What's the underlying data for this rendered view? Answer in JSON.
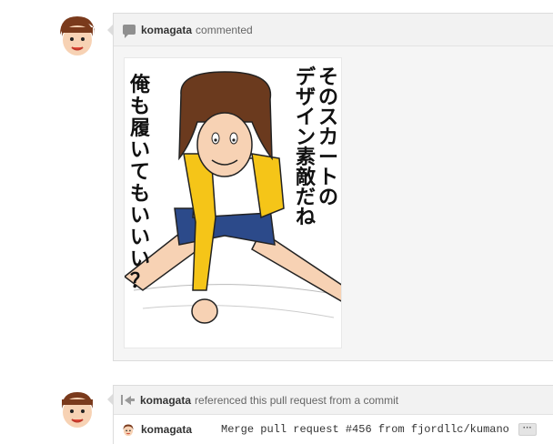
{
  "comment": {
    "author": "komagata",
    "action": "commented",
    "image": {
      "caption_right": "そのスカートのデザイン素敵だね",
      "caption_left": "俺も履いてもいいい？"
    }
  },
  "reference": {
    "author": "komagata",
    "action": "referenced this pull request from a commit",
    "commit": {
      "author": "komagata",
      "message": "Merge pull request #456 from fjordllc/kumano",
      "more_label": "···"
    }
  },
  "colors": {
    "box_border": "#dcdcdc",
    "header_bg": "#f2f2f2",
    "hair": "#6b3a1e",
    "jacket": "#f5c518"
  }
}
